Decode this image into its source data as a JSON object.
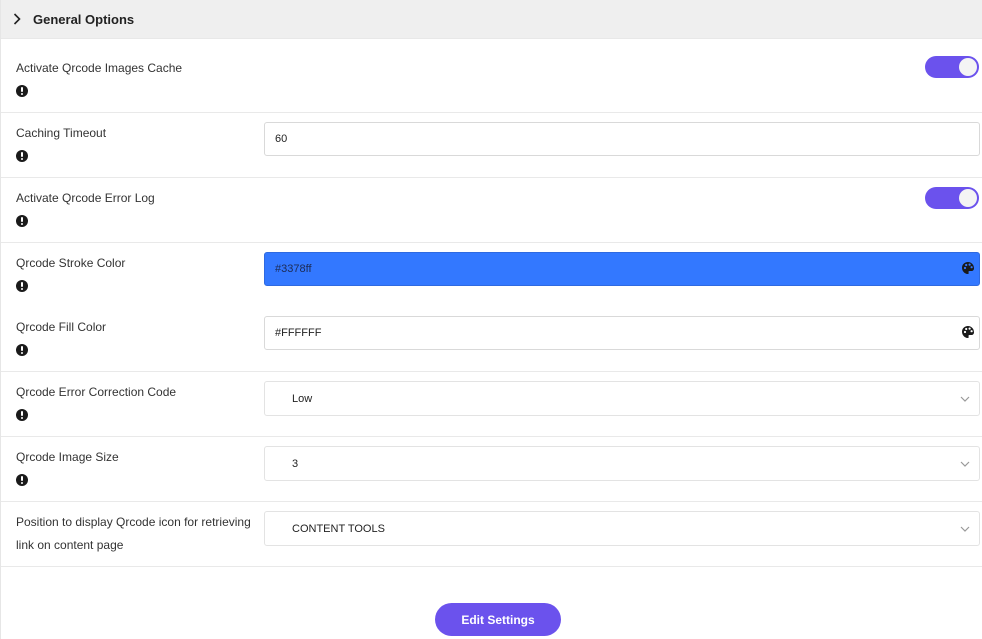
{
  "section": {
    "title": "General Options",
    "icon": "chevron-right-icon"
  },
  "settings": {
    "images_cache": {
      "label": "Activate Qrcode Images Cache",
      "enabled": true
    },
    "caching_timeout": {
      "label": "Caching Timeout",
      "value": "60"
    },
    "error_log": {
      "label": "Activate Qrcode Error Log",
      "enabled": true
    },
    "stroke_color": {
      "label": "Qrcode Stroke Color",
      "value": "#3378ff"
    },
    "fill_color": {
      "label": "Qrcode Fill Color",
      "value": "#FFFFFF"
    },
    "error_correction": {
      "label": "Qrcode Error Correction Code",
      "selected": "Low"
    },
    "image_size": {
      "label": "Qrcode Image Size",
      "selected": "3"
    },
    "icon_position": {
      "label": "Position to display Qrcode icon for retrieving link on content page",
      "selected": "CONTENT TOOLS"
    }
  },
  "actions": {
    "edit_label": "Edit Settings"
  },
  "colors": {
    "accent": "#6b52ed",
    "stroke_swatch": "#3378ff",
    "header_bg": "#efefef"
  }
}
